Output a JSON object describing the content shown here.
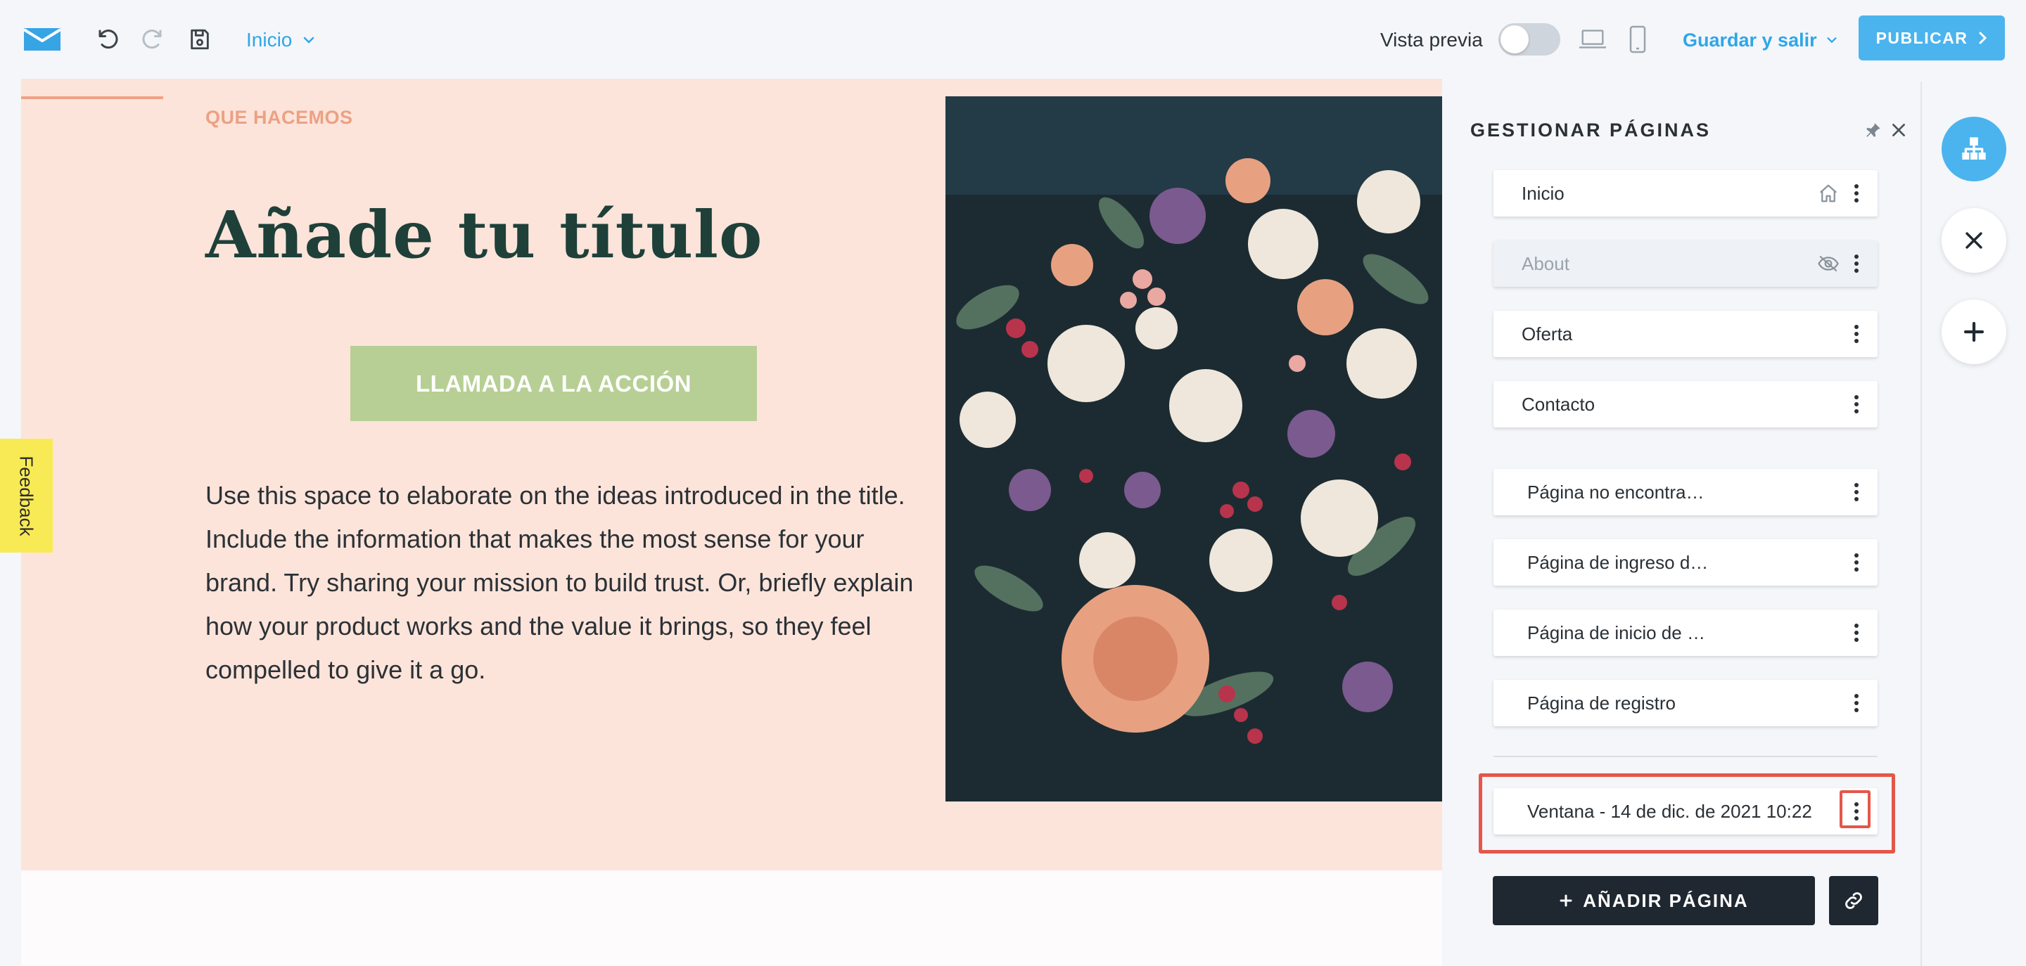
{
  "toolbar": {
    "page_selector": "Inicio",
    "preview_label": "Vista previa",
    "save_exit_label": "Guardar y salir",
    "publish_label": "PUBLICAR"
  },
  "hero": {
    "eyebrow": "QUE HACEMOS",
    "title": "Añade tu título",
    "cta_label": "LLAMADA A LA ACCIÓN",
    "body": "Use this space to elaborate on the ideas introduced in the title. Include the information that makes the most sense for your brand. Try sharing your mission to build trust. Or, briefly explain how your product works and the value it brings, so they feel compelled to give it a go."
  },
  "feedback_label": "Feedback",
  "panel": {
    "title": "GESTIONAR PÁGINAS",
    "main_pages": [
      {
        "label": "Inicio",
        "icon": "home-icon"
      },
      {
        "label": "About",
        "icon": "hidden-eye-icon"
      },
      {
        "label": "Oferta",
        "icon": ""
      },
      {
        "label": "Contacto",
        "icon": ""
      }
    ],
    "system_pages": [
      {
        "label": "Página no encontra…"
      },
      {
        "label": "Página de ingreso d…"
      },
      {
        "label": "Página de inicio de …"
      },
      {
        "label": "Página de registro"
      }
    ],
    "popup_page": {
      "label": "Ventana - 14 de dic. de 2021 10:22"
    },
    "add_page_label": "AÑADIR PÁGINA"
  },
  "colors": {
    "accent": "#4bb4ee",
    "hero_bg": "#fce4da",
    "cta": "#b7cf94",
    "title": "#1e4039",
    "highlight": "#e5564a",
    "dark_button": "#1f2730"
  }
}
